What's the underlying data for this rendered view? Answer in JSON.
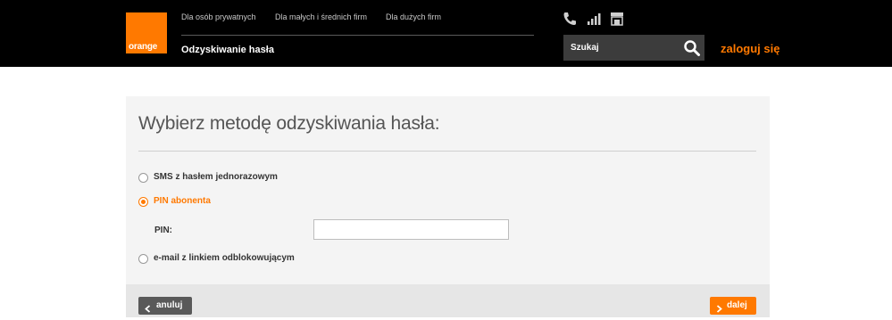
{
  "header": {
    "logo_text": "orange",
    "top_nav": [
      "Dla osób prywatnych",
      "Dla małych i średnich firm",
      "Dla dużych firm"
    ],
    "page_title": "Odzyskiwanie hasła",
    "icons": [
      "phone-icon",
      "signal-icon",
      "store-icon"
    ],
    "search_placeholder": "Szukaj",
    "login_label": "zaloguj się"
  },
  "main": {
    "heading": "Wybierz metodę odzyskiwania hasła:",
    "options": [
      {
        "label": "SMS z hasłem jednorazowym",
        "selected": false
      },
      {
        "label": "PIN abonenta",
        "selected": true
      },
      {
        "label": "e-mail z linkiem odblokowującym",
        "selected": false
      }
    ],
    "pin_label": "PIN:",
    "pin_value": ""
  },
  "footer": {
    "cancel_label": "anuluj",
    "next_label": "dalej"
  },
  "colors": {
    "brand": "#ff7900",
    "header_bg": "#000000",
    "panel_bg": "#f4f4f4",
    "cancel_bg": "#595959"
  }
}
